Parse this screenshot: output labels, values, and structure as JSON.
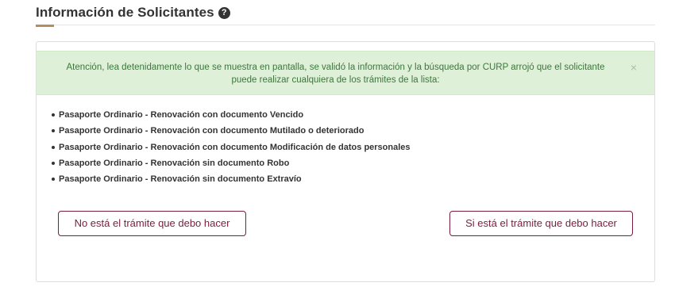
{
  "header": {
    "title": "Información de Solicitantes",
    "help_icon": "?"
  },
  "alert": {
    "message": "Atención, lea detenidamente lo que se muestra en pantalla, se validó la información y la búsqueda por CURP arrojó que el solicitante puede realizar cualquiera de los trámites de la lista:",
    "close_symbol": "×"
  },
  "procedures": [
    "Pasaporte Ordinario - Renovación con documento Vencido",
    "Pasaporte Ordinario - Renovación con documento Mutilado o deteriorado",
    "Pasaporte Ordinario - Renovación con documento Modificación de datos personales",
    "Pasaporte Ordinario - Renovación sin documento Robo",
    "Pasaporte Ordinario - Renovación sin documento Extravío"
  ],
  "actions": {
    "not_found_label": "No está el trámite que debo hacer",
    "found_label": "Si está el trámite que debo hacer"
  },
  "colors": {
    "accent_gold": "#b38e5d",
    "brand_maroon": "#7a1d3f",
    "alert_bg": "#dff0d8",
    "alert_text": "#3c763d"
  }
}
